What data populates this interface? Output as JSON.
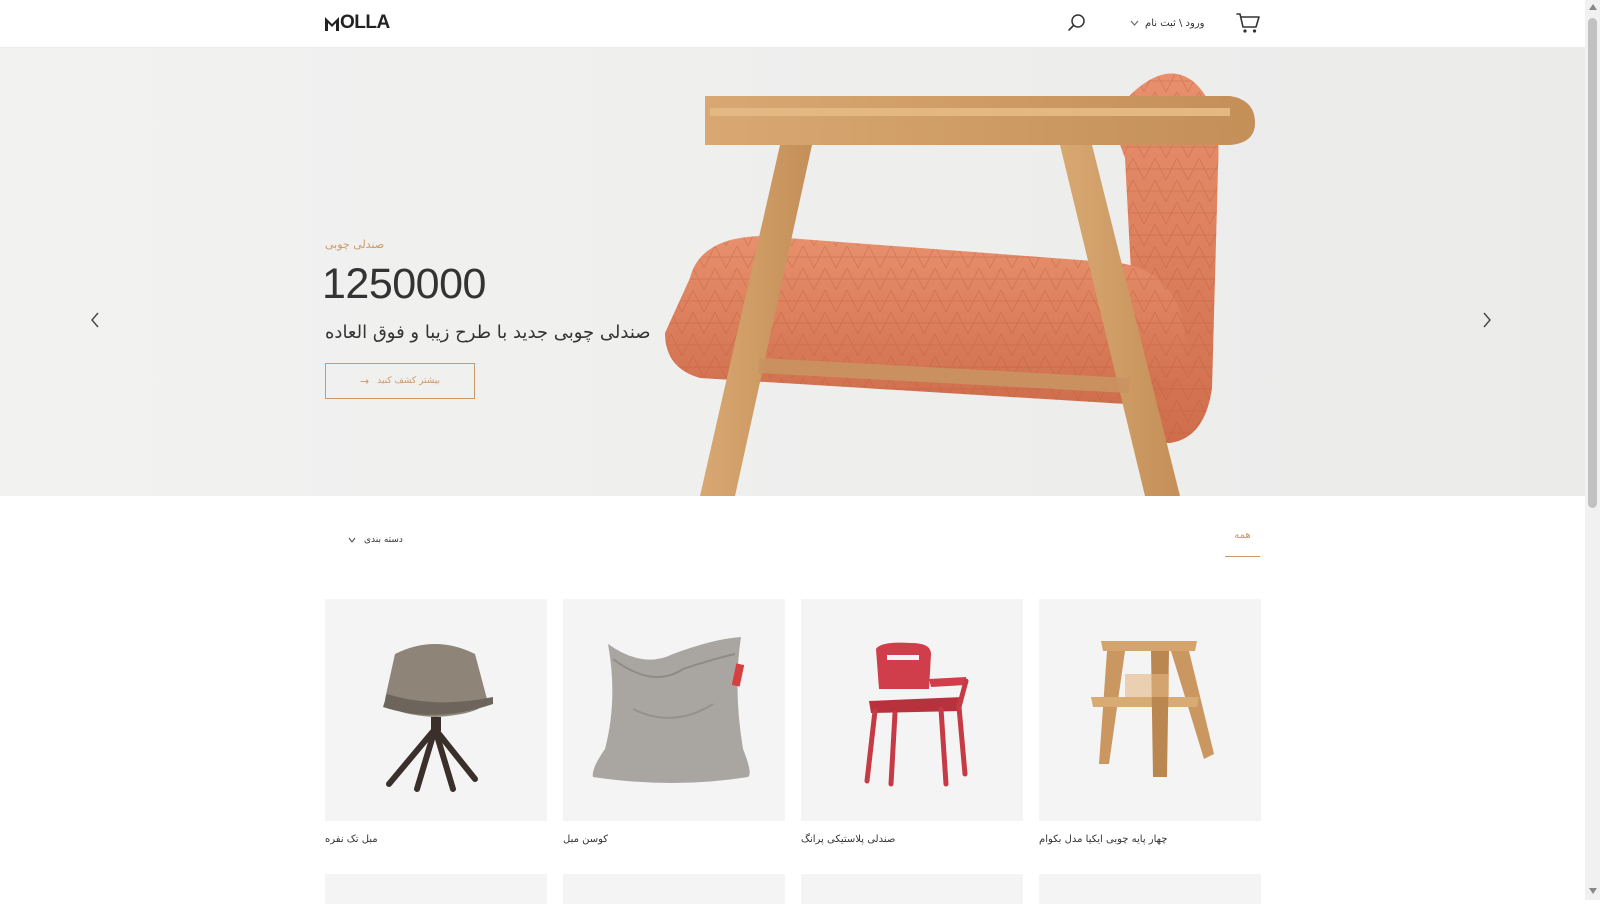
{
  "header": {
    "logo_text": "OLLA",
    "account_label": "ورود \\ ثبت نام",
    "icons": [
      "logo-m-icon",
      "search-icon",
      "chevron-down-icon",
      "cart-icon"
    ]
  },
  "hero": {
    "subtitle": "صندلی چوبی",
    "price": "1250000",
    "title": "صندلی چوبی جدید با طرح زیبا و فوق العاده",
    "button_label": "بیشتر کشف کنید",
    "button_arrow": "→",
    "icons": [
      "chevron-left-icon",
      "chevron-right-icon",
      "arrow-right-icon"
    ]
  },
  "filters": {
    "category_label": "دسته بندی",
    "all_label": "همه"
  },
  "products": [
    {
      "name": "مبل تک نفره"
    },
    {
      "name": "کوسن مبل"
    },
    {
      "name": "صندلی پلاستیکی پرانگ"
    },
    {
      "name": "چهار پایه چوبی ایکیا مدل بکوام"
    }
  ],
  "colors": {
    "accent": "#cc9966",
    "text": "#333333",
    "hero_bg": "#efefee",
    "product_bg": "#f4f4f4"
  }
}
